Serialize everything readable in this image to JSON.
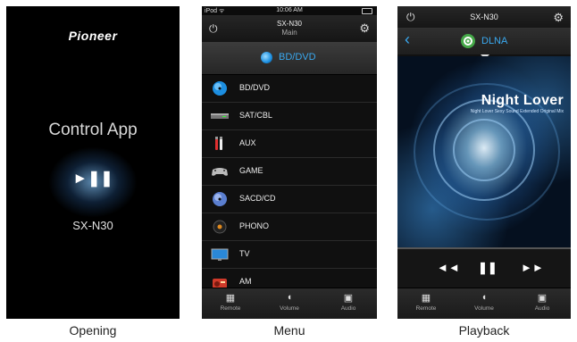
{
  "opening": {
    "brand": "Pioneer",
    "app_title": "Control App",
    "play_pause_glyph": "►❚❚",
    "model": "SX-N30",
    "caption": "Opening"
  },
  "menu": {
    "status": {
      "left": "iPod ᯤ",
      "time": "10:06 AM"
    },
    "header": {
      "model": "SX-N30",
      "zone": "Main"
    },
    "selected_input": "BD/DVD",
    "items": [
      {
        "label": "BD/DVD",
        "icon": "disc-icon"
      },
      {
        "label": "SAT/CBL",
        "icon": "set-top-box-icon"
      },
      {
        "label": "AUX",
        "icon": "rca-cable-icon"
      },
      {
        "label": "GAME",
        "icon": "gamepad-icon"
      },
      {
        "label": "SACD/CD",
        "icon": "cd-icon"
      },
      {
        "label": "PHONO",
        "icon": "record-icon"
      },
      {
        "label": "TV",
        "icon": "tv-icon"
      },
      {
        "label": "AM",
        "icon": "radio-icon"
      }
    ],
    "tabs": [
      {
        "label": "Remote",
        "icon": "remote-icon"
      },
      {
        "label": "Volume",
        "icon": "speaker-icon"
      },
      {
        "label": "Audio",
        "icon": "audio-icon"
      }
    ],
    "caption": "Menu"
  },
  "playback": {
    "header": {
      "model": "SX-N30"
    },
    "source": "DLNA",
    "track_title": "Night Lover",
    "track_subtitle": "Night Lover  Sexy Sound Extended Original Mix",
    "controls": {
      "prev": "◄◄",
      "pause": "❚❚",
      "next": "►►"
    },
    "tabs": [
      {
        "label": "Remote",
        "icon": "remote-icon"
      },
      {
        "label": "Volume",
        "icon": "speaker-icon"
      },
      {
        "label": "Audio",
        "icon": "audio-icon"
      }
    ],
    "caption": "Playback"
  }
}
